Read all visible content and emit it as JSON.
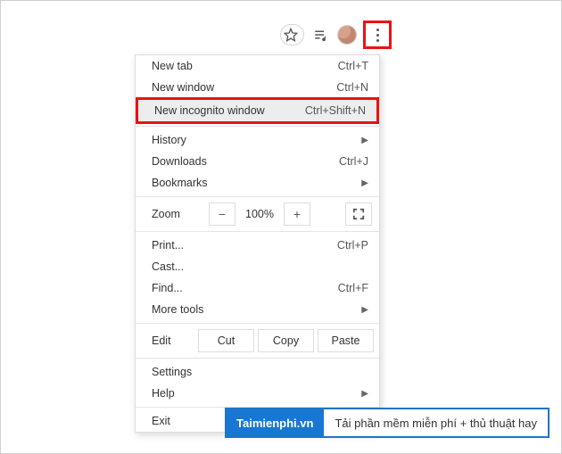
{
  "toolbar": {
    "star_icon": "star-icon",
    "playlist_icon": "media-queue-icon",
    "profile": "profile-avatar",
    "menu_button": "menu-button"
  },
  "menu": {
    "new_tab": {
      "label": "New tab",
      "accel": "Ctrl+T"
    },
    "new_window": {
      "label": "New window",
      "accel": "Ctrl+N"
    },
    "new_incognito": {
      "label": "New incognito window",
      "accel": "Ctrl+Shift+N"
    },
    "history": {
      "label": "History"
    },
    "downloads": {
      "label": "Downloads",
      "accel": "Ctrl+J"
    },
    "bookmarks": {
      "label": "Bookmarks"
    },
    "zoom": {
      "label": "Zoom",
      "minus": "−",
      "value": "100%",
      "plus": "+"
    },
    "print": {
      "label": "Print...",
      "accel": "Ctrl+P"
    },
    "cast": {
      "label": "Cast..."
    },
    "find": {
      "label": "Find...",
      "accel": "Ctrl+F"
    },
    "more_tools": {
      "label": "More tools"
    },
    "edit": {
      "label": "Edit",
      "cut": "Cut",
      "copy": "Copy",
      "paste": "Paste"
    },
    "settings": {
      "label": "Settings"
    },
    "help": {
      "label": "Help"
    },
    "exit": {
      "label": "Exit"
    }
  },
  "footer": {
    "brand": "Taimienphi.vn",
    "tagline": "Tải phần mềm miễn phí + thủ thuật hay"
  }
}
